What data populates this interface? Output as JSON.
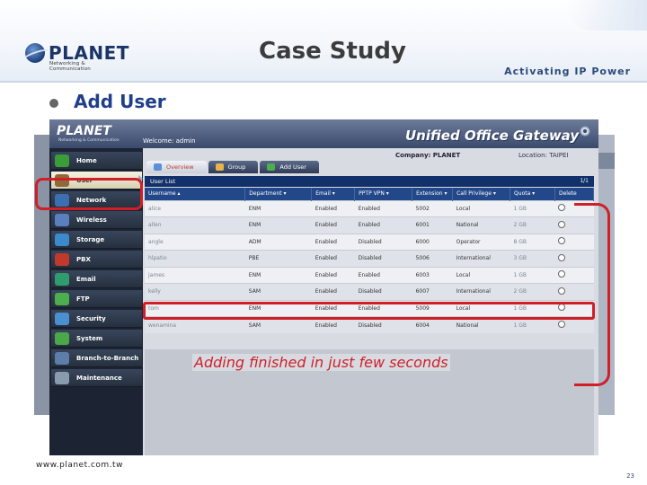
{
  "slide": {
    "title": "Case Study",
    "logo_word": "PLANET",
    "logo_tagline": "Networking & Communication",
    "tagline": "Activating IP Power",
    "bullet": "Add User",
    "footer_url": "www.planet.com.tw",
    "page_number": "23",
    "caption": "Adding finished in just few seconds",
    "accent_color": "#d01f27",
    "title_color": "#3c3c3c",
    "bullet_color": "#1f3f8a"
  },
  "app": {
    "logo": "PLANET",
    "logo_tagline": "Networking & Communication",
    "welcome": "Welcome: admin",
    "product_name": "Unified Office Gateway",
    "company": "Company: PLANET",
    "location": "Location: TAIPEI",
    "menu": [
      {
        "label": "Home",
        "icon": "house-icon",
        "icon_color": "#3a9d3a"
      },
      {
        "label": "User",
        "icon": "user-icon",
        "icon_color": "#8c6a3a",
        "active": true
      },
      {
        "label": "Network",
        "icon": "network-icon",
        "icon_color": "#3a6fb0"
      },
      {
        "label": "Wireless",
        "icon": "wireless-icon",
        "icon_color": "#5a7fbf"
      },
      {
        "label": "Storage",
        "icon": "storage-icon",
        "icon_color": "#3b8ac9"
      },
      {
        "label": "PBX",
        "icon": "phone-icon",
        "icon_color": "#c0392b"
      },
      {
        "label": "Email",
        "icon": "email-icon",
        "icon_color": "#2f9b6e"
      },
      {
        "label": "FTP",
        "icon": "folder-icon",
        "icon_color": "#4cae4c"
      },
      {
        "label": "Security",
        "icon": "shield-icon",
        "icon_color": "#4a8fd0"
      },
      {
        "label": "System",
        "icon": "system-icon",
        "icon_color": "#4aa84a"
      },
      {
        "label": "Branch-to-Branch",
        "icon": "branch-icon",
        "icon_color": "#5c7ea8"
      },
      {
        "label": "Maintenance",
        "icon": "tools-icon",
        "icon_color": "#8a9bb0"
      }
    ],
    "tabs": [
      {
        "label": "Overview",
        "icon_color": "#5b8fd6",
        "active": true
      },
      {
        "label": "Group",
        "icon_color": "#e8b34a"
      },
      {
        "label": "Add User",
        "icon_color": "#4cae4c"
      }
    ],
    "list_title": "User List",
    "list_page": "1/1",
    "columns": [
      "Username ▴",
      "Department ▾",
      "Email ▾",
      "PPTP VPN ▾",
      "Extension ▾",
      "Call Privilege ▾",
      "Quota ▾",
      "Delete"
    ],
    "rows": [
      [
        "alice",
        "ENM",
        "Enabled",
        "Enabled",
        "5002",
        "Local",
        "1 GB"
      ],
      [
        "allen",
        "ENM",
        "Enabled",
        "Enabled",
        "6001",
        "National",
        "2 GB"
      ],
      [
        "angle",
        "ADM",
        "Enabled",
        "Disabled",
        "6000",
        "Operator",
        "8 GB"
      ],
      [
        "hlpatio",
        "PBE",
        "Enabled",
        "Disabled",
        "5006",
        "International",
        "3 GB"
      ],
      [
        "james",
        "ENM",
        "Enabled",
        "Enabled",
        "6003",
        "Local",
        "1 GB"
      ],
      [
        "kelly",
        "SAM",
        "Enabled",
        "Disabled",
        "6007",
        "International",
        "2 GB"
      ],
      [
        "tom",
        "ENM",
        "Enabled",
        "Enabled",
        "5009",
        "Local",
        "1 GB"
      ],
      [
        "wenamina",
        "SAM",
        "Enabled",
        "Disabled",
        "6004",
        "National",
        "1 GB"
      ]
    ],
    "header_color": "#23488a",
    "highlighted_row": "tom"
  }
}
